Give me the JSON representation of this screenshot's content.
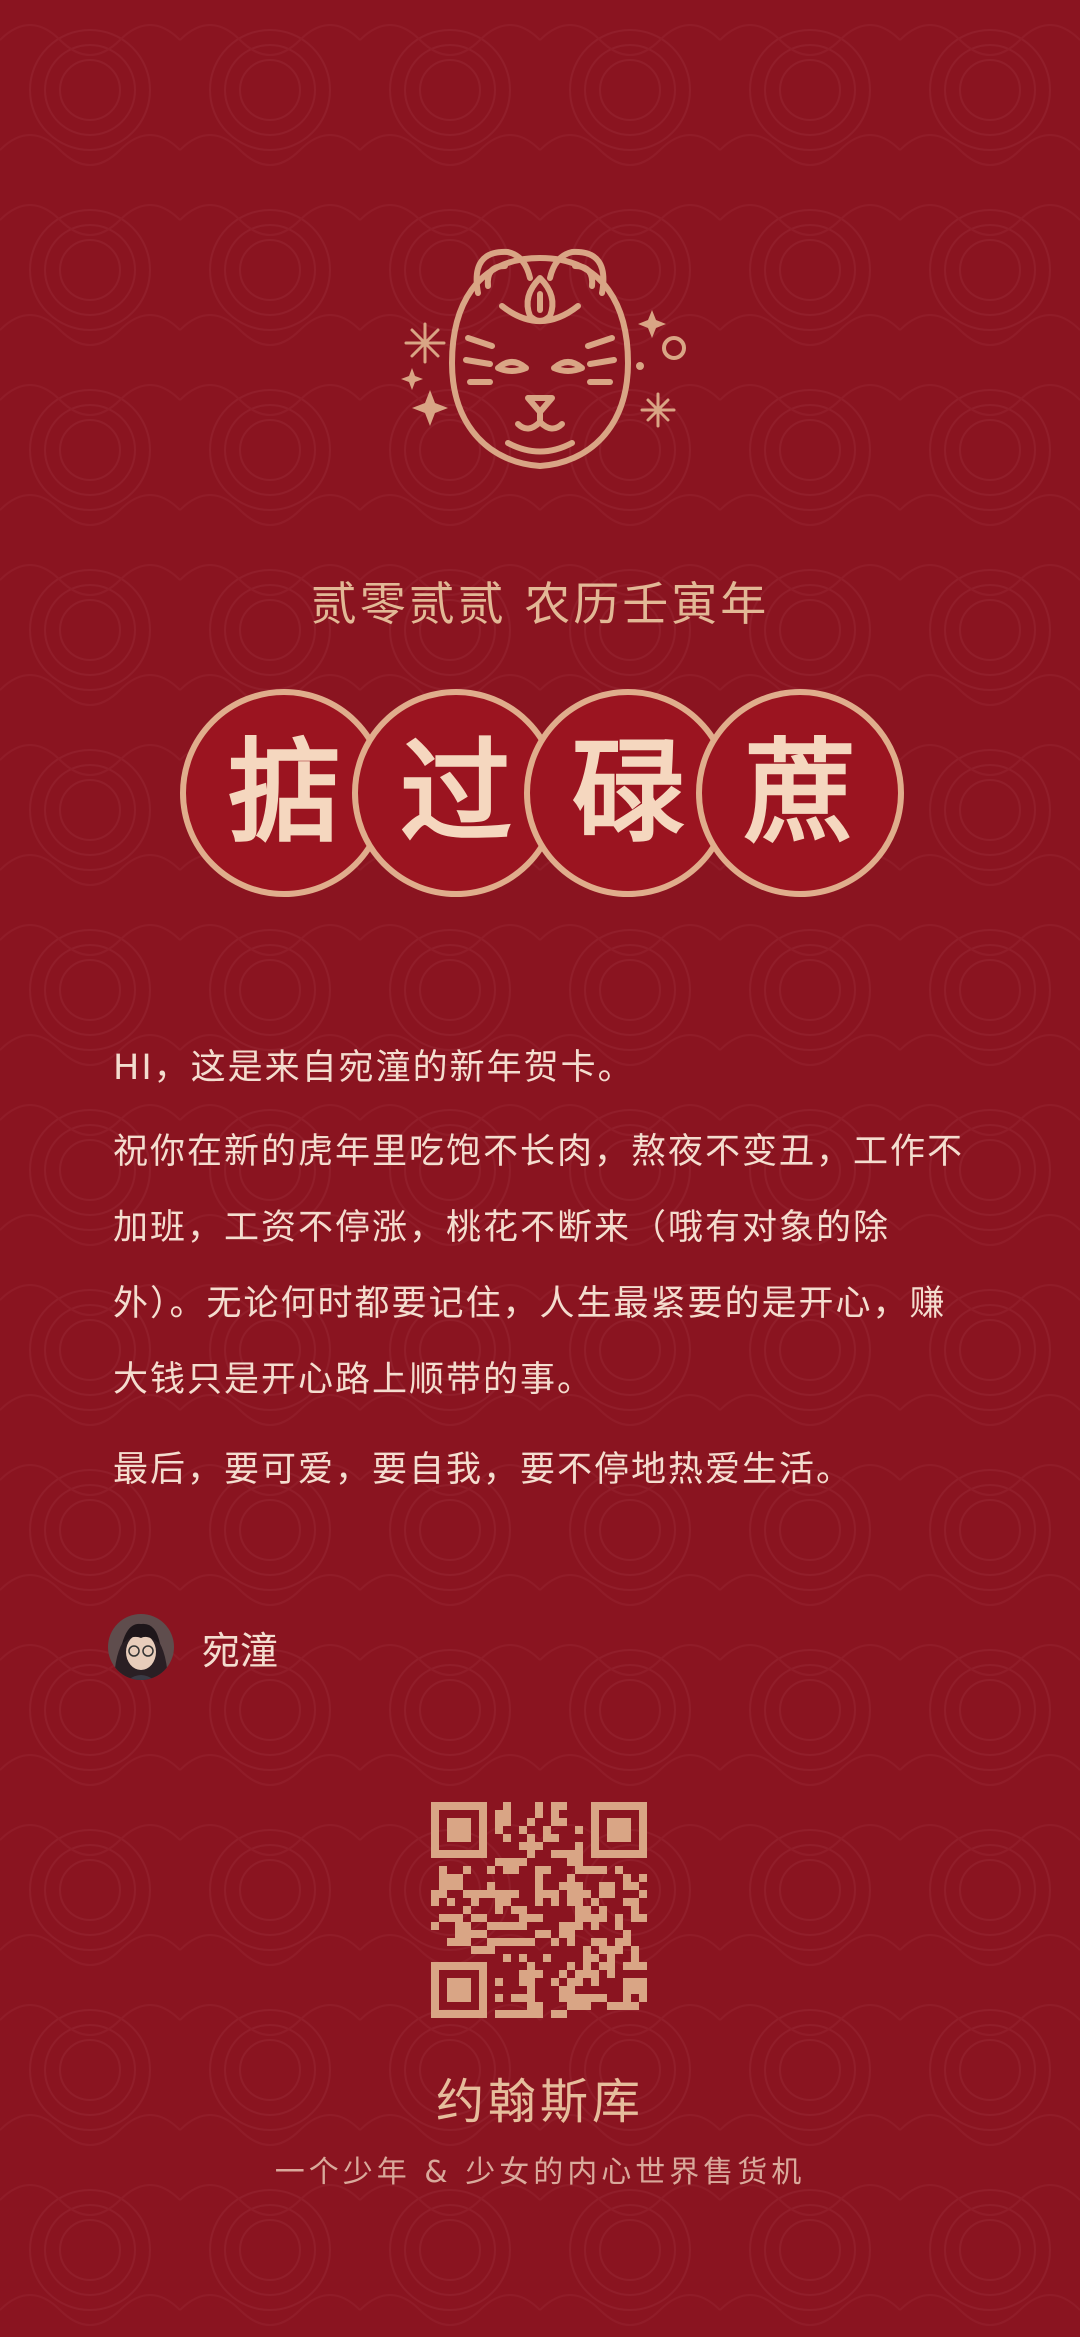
{
  "card": {
    "year_line": "贰零贰贰 农历壬寅年",
    "blessing_chars": [
      "掂",
      "过",
      "碌",
      "蔗"
    ],
    "greeting": "HI，这是来自宛潼的新年贺卡。",
    "wish": "祝你在新的虎年里吃饱不长肉，熬夜不变丑，工作不加班，工资不停涨，桃花不断来（哦有对象的除外）。无论何时都要记住，人生最紧要的是开心，赚大钱只是开心路上顺带的事。",
    "closing": "最后，要可爱，要自我，要不停地热爱生活。",
    "signer": "宛潼"
  },
  "footer": {
    "brand": "约翰斯库",
    "slogan": "一个少年 & 少女的内心世界售货机"
  },
  "icons": {
    "tiger": "tiger-head-icon",
    "avatar": "avatar-photo",
    "qr": "qr-code"
  },
  "colors": {
    "background": "#8a1420",
    "gold": "#e0ad8c",
    "text": "#f4ddcf"
  }
}
